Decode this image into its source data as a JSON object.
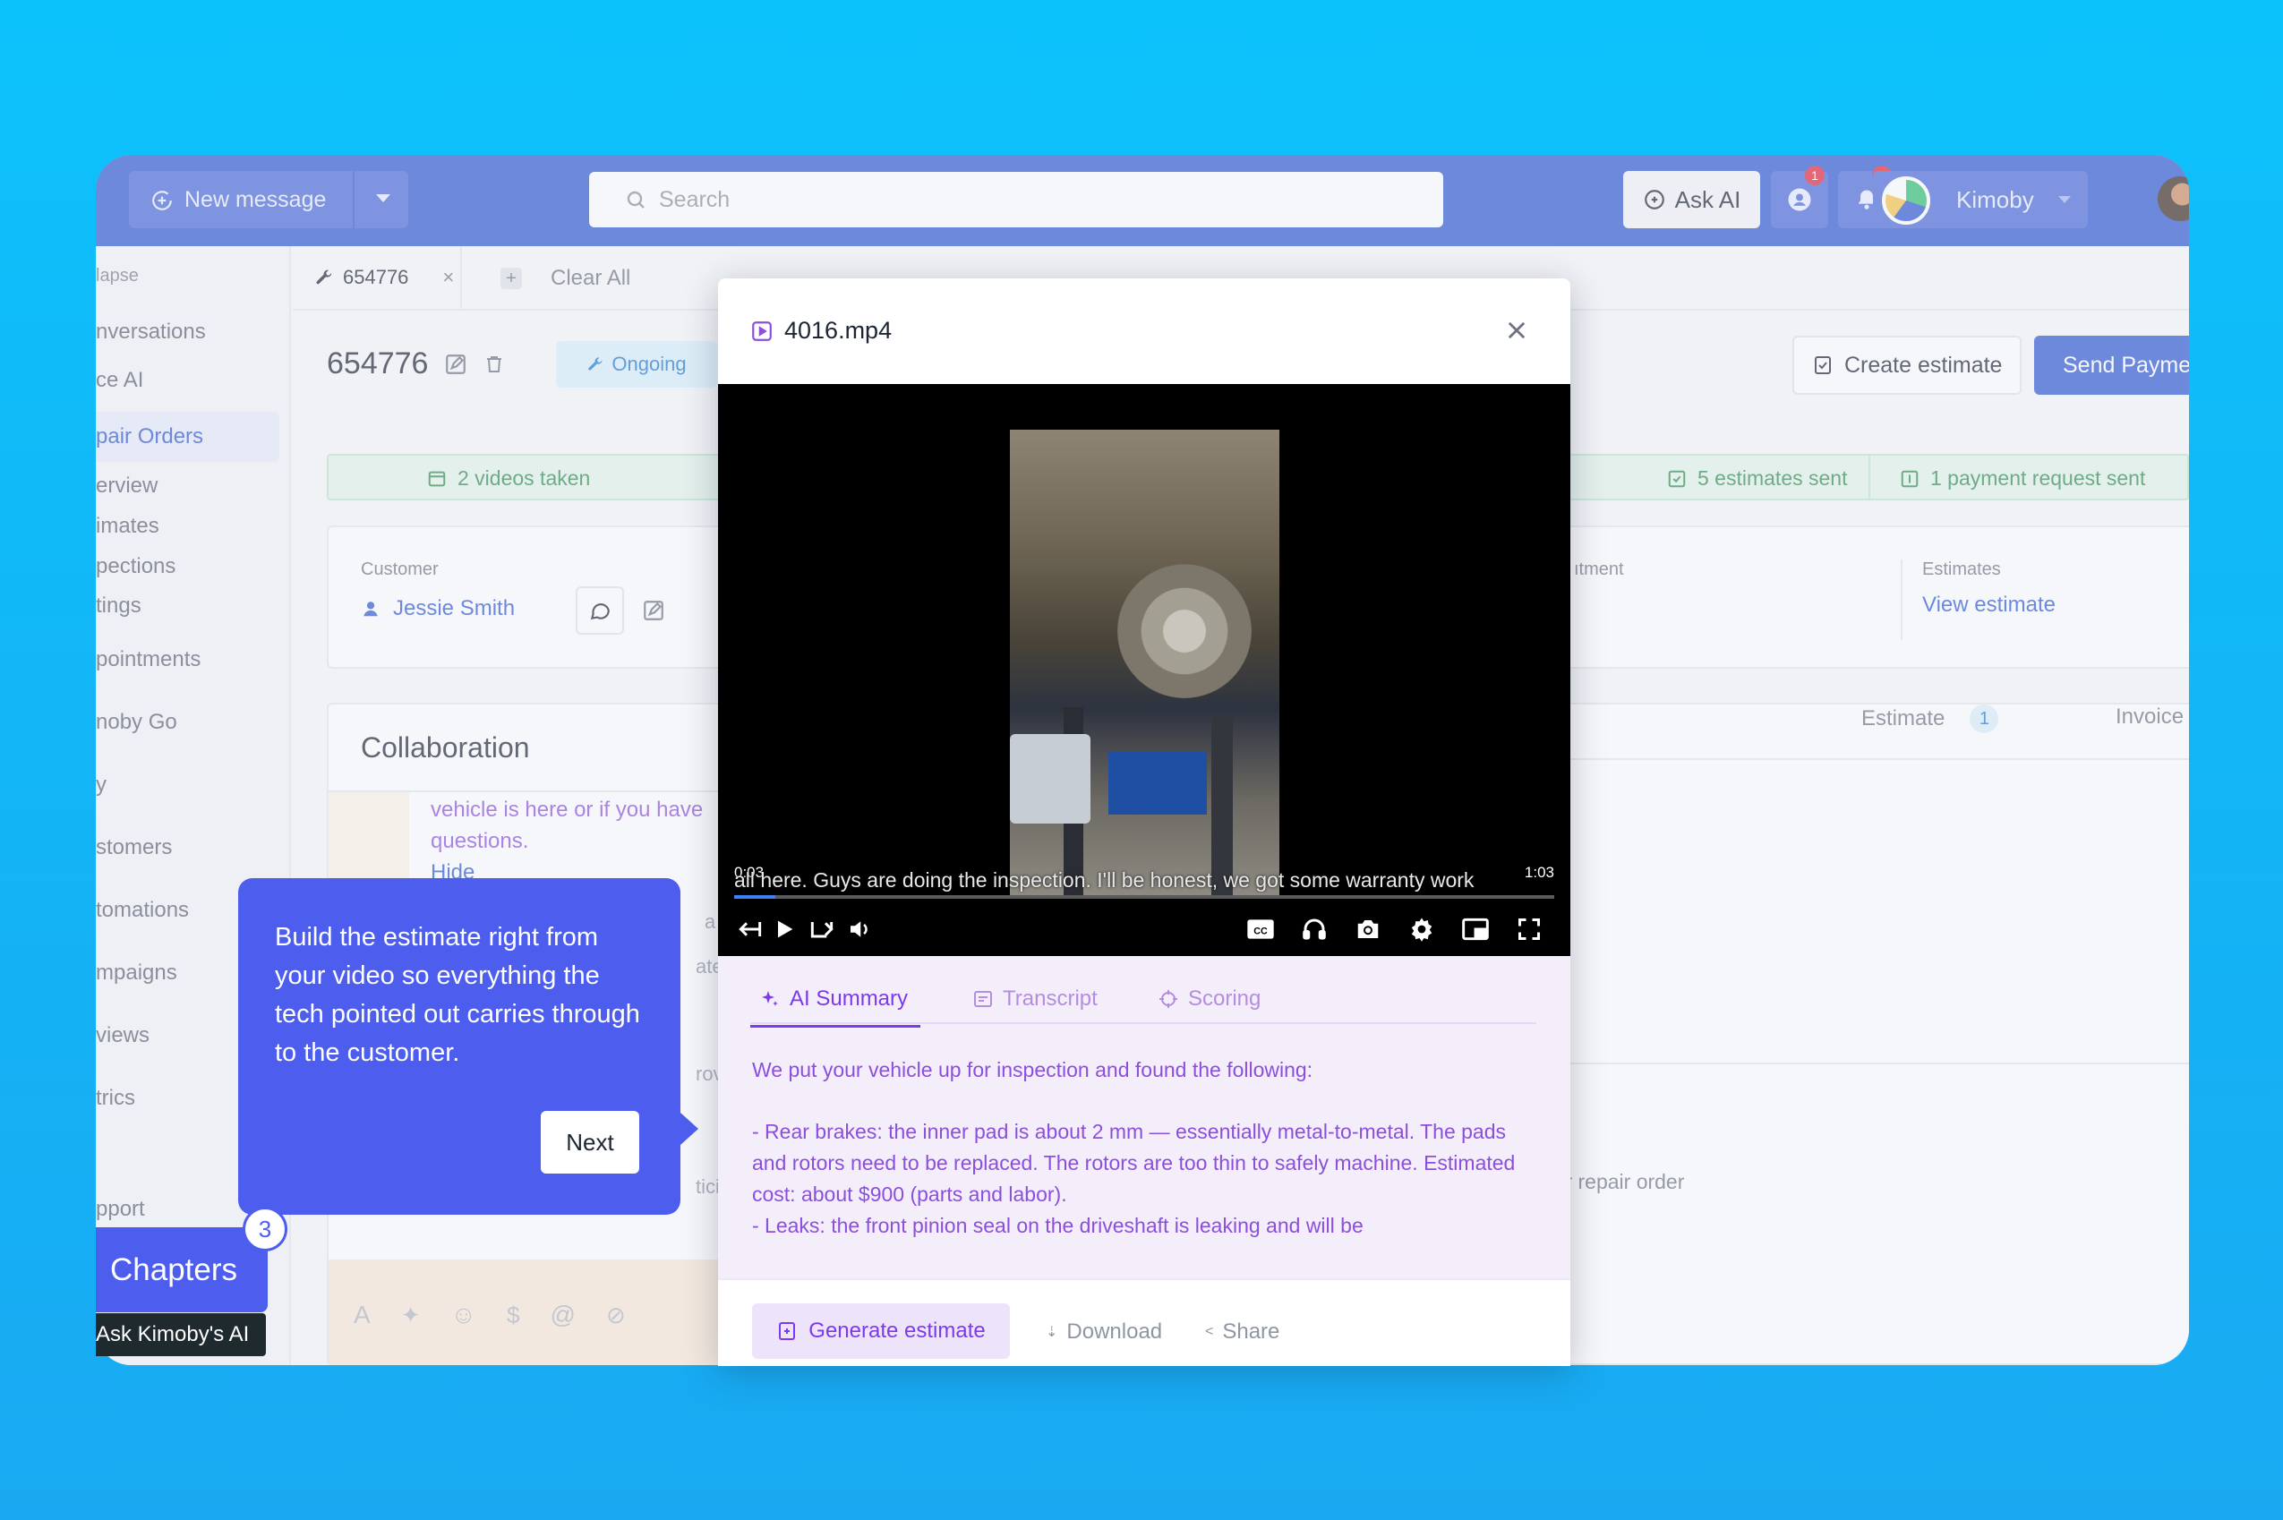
{
  "topbar": {
    "new_message": "New message",
    "search_placeholder": "Search",
    "ask_ai": "Ask AI",
    "chat_badge": "1",
    "notif_badge": "4",
    "account_name": "Kimoby"
  },
  "sidebar": {
    "collapse": "lapse",
    "items": [
      "nversations",
      "ce AI",
      "pair Orders",
      "erview",
      "imates",
      "pections",
      "tings",
      "pointments",
      "noby Go",
      "y",
      "stomers",
      "tomations",
      "mpaigns",
      "views",
      "trics",
      "pport"
    ]
  },
  "tabs": {
    "ro_tab": "654776",
    "close": "×",
    "add": "+",
    "clear_all": "Clear All"
  },
  "repair_order": {
    "number": "654776",
    "status": "Ongoing",
    "create_estimate": "Create estimate",
    "send_payment": "Send Payment Requ"
  },
  "stats": {
    "videos": "2 videos taken",
    "estimates": "5 estimates sent",
    "payments": "1 payment request sent"
  },
  "customer": {
    "label": "Customer",
    "name": "Jessie Smith",
    "appointment_label": "ıtment",
    "estimates_label": "Estimates",
    "view_estimate": "View estimate"
  },
  "collab": {
    "title": "Collaboration",
    "msg1": "vehicle is here or if you have",
    "msg2": "questions.",
    "hide": "Hide",
    "right_tabs": {
      "estimate": "Estimate",
      "estimate_count": "1",
      "invoice": "Invoice"
    },
    "info_text": "formation for repair order",
    "fragments": {
      "a": "a Lo",
      "b": "ate",
      "c": "rove",
      "d": "ticip"
    }
  },
  "modal": {
    "file_name": "4016.mp4",
    "video": {
      "time_current": "0:03",
      "time_total": "1:03",
      "caption": "all here. Guys are doing the inspection. I'll be honest, we got some warranty work",
      "progress": 0.05
    },
    "tabs": {
      "summary": "AI Summary",
      "transcript": "Transcript",
      "scoring": "Scoring"
    },
    "summary": {
      "intro": "We put your vehicle up for inspection and found the following:",
      "item1": "- Rear brakes: the inner pad is about 2 mm — essentially metal-to-metal. The pads and rotors need to be replaced. The rotors are too thin to safely machine. Estimated cost: about $900 (parts and labor).",
      "item2": "- Leaks: the front pinion seal on the driveshaft is leaking and will be"
    },
    "footer": {
      "generate": "Generate estimate",
      "download": "Download",
      "share": "Share"
    }
  },
  "tooltip": {
    "text": "Build the estimate right from your video so everything the tech pointed out carries through to the customer.",
    "next": "Next"
  },
  "chapters": {
    "label": "Chapters",
    "badge": "3",
    "ask": "Ask Kimoby's AI"
  },
  "colors": {
    "brand": "#2b56cf",
    "accent": "#4d5eee",
    "purple": "#7c3aed",
    "success": "#2e8a4e"
  }
}
